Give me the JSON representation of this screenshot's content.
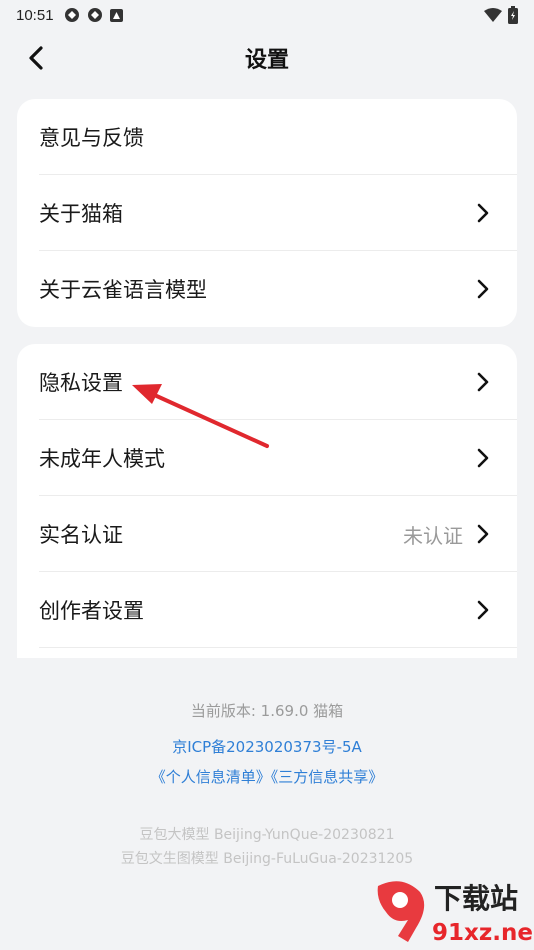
{
  "status_bar": {
    "time": "10:51",
    "icons": [
      "app-icon-1",
      "app-icon-2",
      "notification-icon"
    ],
    "right_icons": [
      "wifi-icon",
      "battery-icon"
    ]
  },
  "header": {
    "title": "设置",
    "back_icon": "chevron-left-icon"
  },
  "card1": {
    "items": [
      {
        "label": "意见与反馈",
        "has_chevron": false
      },
      {
        "label": "关于猫箱",
        "has_chevron": true
      },
      {
        "label": "关于云雀语言模型",
        "has_chevron": true
      }
    ]
  },
  "card2": {
    "items": [
      {
        "label": "隐私设置",
        "has_chevron": true
      },
      {
        "label": "未成年人模式",
        "has_chevron": true
      },
      {
        "label": "实名认证",
        "value": "未认证",
        "has_chevron": true
      },
      {
        "label": "创作者设置",
        "has_chevron": true
      }
    ]
  },
  "footer": {
    "version": "当前版本: 1.69.0 猫箱",
    "icp": "京ICP备2023020373号-5A",
    "links": "《个人信息清单》《三方信息共享》",
    "model1": "豆包大模型 Beijing-YunQue-20230821",
    "model2": "豆包文生图模型 Beijing-FuLuGua-20231205"
  },
  "watermark": {
    "logo_text": "下载站",
    "site": "91xz.net"
  },
  "colors": {
    "background": "#f2f3f5",
    "card": "#ffffff",
    "link": "#2f7fd6",
    "annotation_arrow": "#e0282e"
  }
}
